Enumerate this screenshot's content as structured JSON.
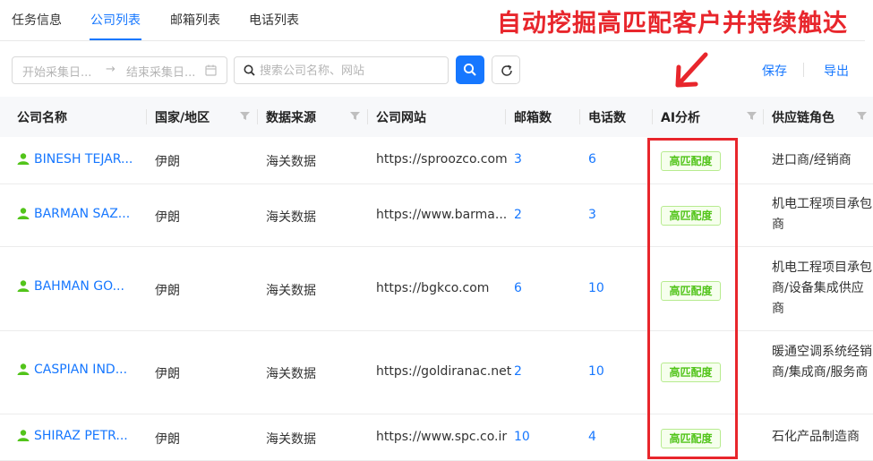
{
  "tabs": [
    {
      "label": "任务信息",
      "active": false
    },
    {
      "label": "公司列表",
      "active": true
    },
    {
      "label": "邮箱列表",
      "active": false
    },
    {
      "label": "电话列表",
      "active": false
    }
  ],
  "headline": "自动挖掘高匹配客户并持续触达",
  "toolbar": {
    "start_placeholder": "开始采集日...",
    "range_arrow": "→",
    "end_placeholder": "结束采集日...",
    "search_placeholder": "搜索公司名称、网站",
    "save_label": "保存",
    "export_label": "导出"
  },
  "table": {
    "columns": [
      "公司名称",
      "国家/地区",
      "数据来源",
      "公司网站",
      "邮箱数",
      "电话数",
      "AI分析",
      "供应链角色"
    ],
    "rows": [
      {
        "company": "BINESH TEJAR...",
        "country": "伊朗",
        "source": "海关数据",
        "website": "https://sproozco.com",
        "emails": "3",
        "phones": "6",
        "ai": "高匹配度",
        "role": "进口商/经销商"
      },
      {
        "company": "BARMAN SAZ...",
        "country": "伊朗",
        "source": "海关数据",
        "website": "https://www.barma...",
        "emails": "2",
        "phones": "3",
        "ai": "高匹配度",
        "role": "机电工程项目承包商"
      },
      {
        "company": "BAHMAN GO...",
        "country": "伊朗",
        "source": "海关数据",
        "website": "https://bgkco.com",
        "emails": "6",
        "phones": "10",
        "ai": "高匹配度",
        "role": "机电工程项目承包商/设备集成供应商"
      },
      {
        "company": "CASPIAN IND...",
        "country": "伊朗",
        "source": "海关数据",
        "website": "https://goldiranac.net",
        "emails": "2",
        "phones": "10",
        "ai": "高匹配度",
        "role": "暖通空调系统经销商/集成商/服务商"
      },
      {
        "company": "SHIRAZ PETR...",
        "country": "伊朗",
        "source": "海关数据",
        "website": "https://www.spc.co.ir",
        "emails": "10",
        "phones": "4",
        "ai": "高匹配度",
        "role": "石化产品制造商"
      }
    ]
  },
  "colors": {
    "accent": "#1677ff",
    "highlight": "#e8262c",
    "tag_green": "#52c41a",
    "user_icon": "#52c41a"
  }
}
